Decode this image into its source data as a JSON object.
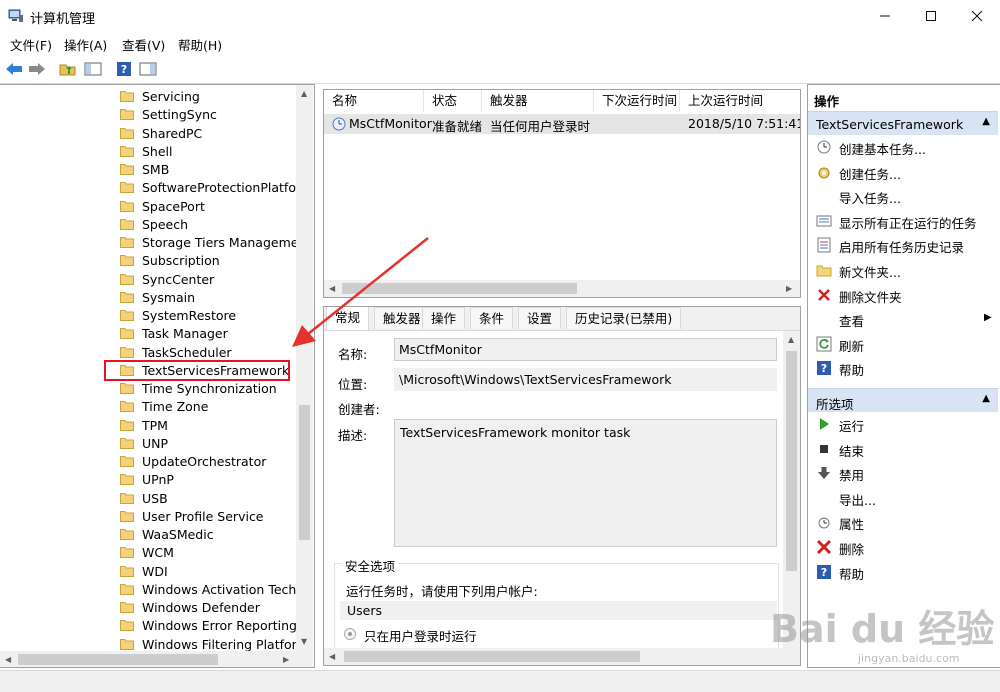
{
  "window": {
    "title": "计算机管理"
  },
  "menu": [
    "文件(F)",
    "操作(A)",
    "查看(V)",
    "帮助(H)"
  ],
  "tree": {
    "items": [
      "Servicing",
      "SettingSync",
      "SharedPC",
      "Shell",
      "SMB",
      "SoftwareProtectionPlatform",
      "SpacePort",
      "Speech",
      "Storage Tiers Management",
      "Subscription",
      "SyncCenter",
      "Sysmain",
      "SystemRestore",
      "Task Manager",
      "TaskScheduler",
      "TextServicesFramework",
      "Time Synchronization",
      "Time Zone",
      "TPM",
      "UNP",
      "UpdateOrchestrator",
      "UPnP",
      "USB",
      "User Profile Service",
      "WaaSMedic",
      "WCM",
      "WDI",
      "Windows Activation Techno",
      "Windows Defender",
      "Windows Error Reporting",
      "Windows Filtering Platform"
    ],
    "selected_index": 15
  },
  "task_list": {
    "columns": [
      "名称",
      "状态",
      "触发器",
      "下次运行时间",
      "上次运行时间"
    ],
    "rows": [
      {
        "name": "MsCtfMonitor",
        "status": "准备就绪",
        "trigger": "当任何用户登录时",
        "next_run": "",
        "last_run": "2018/5/10 7:51:41"
      }
    ]
  },
  "detail_tabs": [
    "常规",
    "触发器",
    "操作",
    "条件",
    "设置",
    "历史记录(已禁用)"
  ],
  "general": {
    "name_label": "名称:",
    "name_value": "MsCtfMonitor",
    "location_label": "位置:",
    "location_value": "\\Microsoft\\Windows\\TextServicesFramework",
    "author_label": "创建者:",
    "desc_label": "描述:",
    "desc_value": "TextServicesFramework monitor task",
    "security_title": "安全选项",
    "run_as_label": "运行任务时，请使用下列用户帐户:",
    "run_as_value": "Users",
    "radio_label": "只在用户登录时运行"
  },
  "actions": {
    "header": "操作",
    "section1": "TextServicesFramework",
    "items1": [
      "创建基本任务...",
      "创建任务...",
      "导入任务...",
      "显示所有正在运行的任务",
      "启用所有任务历史记录",
      "新文件夹...",
      "删除文件夹",
      "查看",
      "刷新",
      "帮助"
    ],
    "section2": "所选项",
    "items2": [
      "运行",
      "结束",
      "禁用",
      "导出...",
      "属性",
      "删除",
      "帮助"
    ]
  },
  "watermark": {
    "brand": "Bai du 经验",
    "url": "jingyan.baidu.com"
  },
  "colors": {
    "accent": "#d8e4f4",
    "selection_box": "#e81123",
    "annotation_arrow": "#e5322d"
  }
}
